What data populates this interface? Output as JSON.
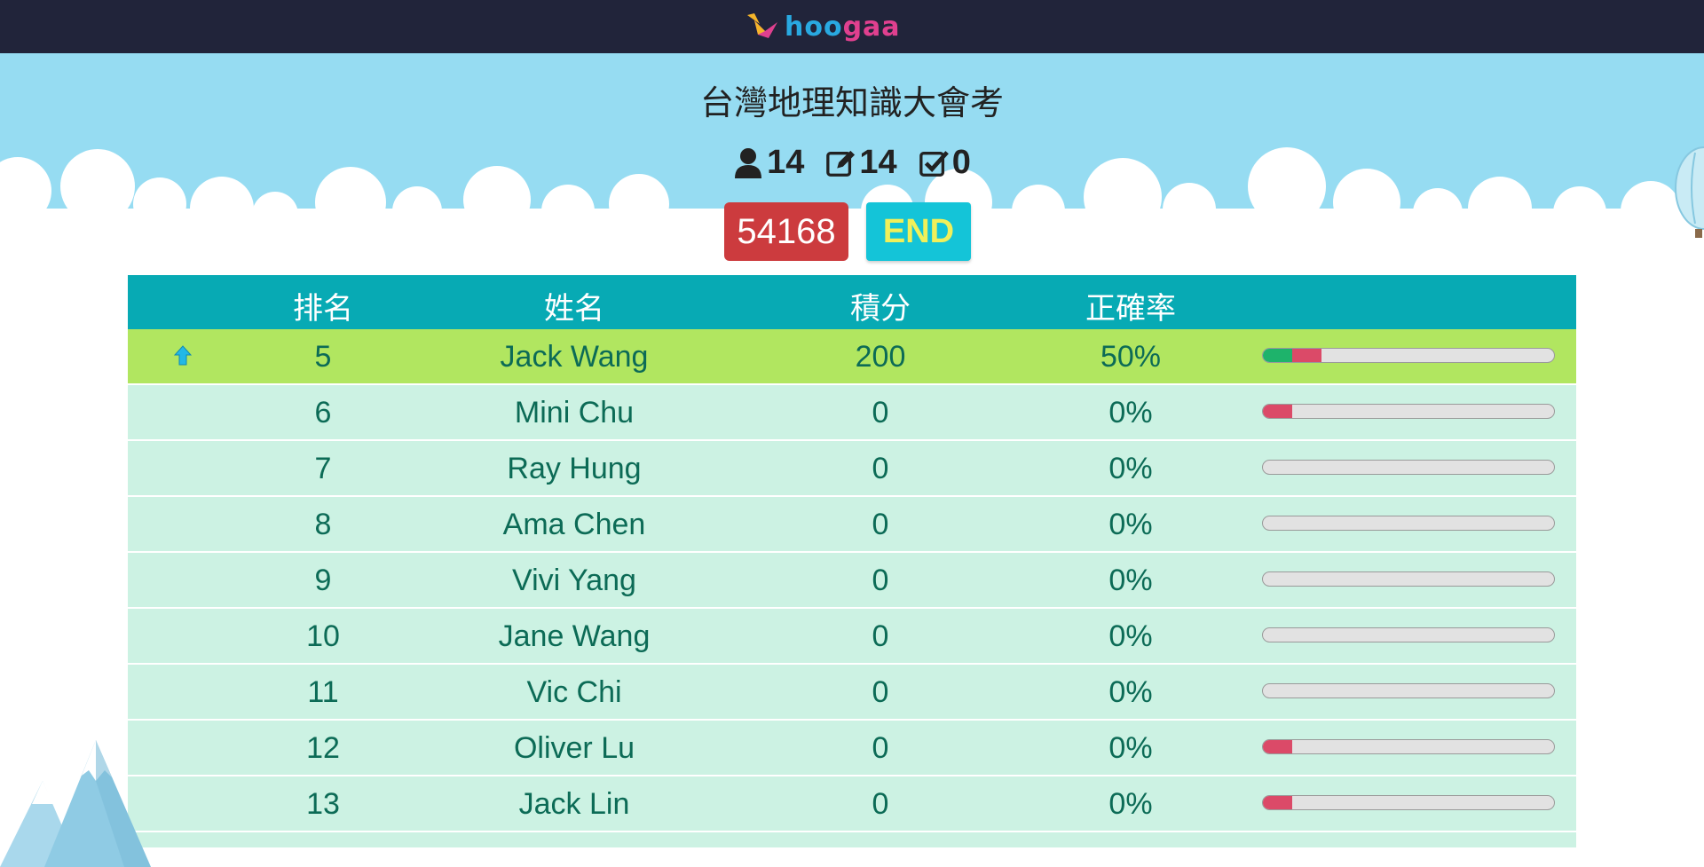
{
  "brand": {
    "logo_text_part1": "hoo",
    "logo_text_part2": "gaa",
    "colors": {
      "hoo": "#29a9e1",
      "gaa": "#e0408f",
      "bird_yellow": "#f5b52a",
      "bird_pink": "#e0408f"
    }
  },
  "quiz": {
    "title": "台灣地理知識大會考"
  },
  "stats": {
    "participants": {
      "icon": "user-icon",
      "value": "14"
    },
    "answered": {
      "icon": "edit-icon",
      "value": "14"
    },
    "correct": {
      "icon": "check-square-icon",
      "value": "0"
    }
  },
  "pin": {
    "value": "54168",
    "color": "#cc3b3e"
  },
  "end_button": {
    "label": "END",
    "color": "#14c4d8"
  },
  "table": {
    "headers": {
      "rank": "排名",
      "name": "姓名",
      "score": "積分",
      "accuracy": "正確率"
    },
    "rows": [
      {
        "rank": "5",
        "name": "Jack Wang",
        "score": "200",
        "accuracy": "50%",
        "trend": "up-arrow-icon",
        "highlight": true,
        "correct_fraction": 0.1,
        "wrong_fraction": 0.1
      },
      {
        "rank": "6",
        "name": "Mini Chu",
        "score": "0",
        "accuracy": "0%",
        "correct_fraction": 0,
        "wrong_fraction": 0.1
      },
      {
        "rank": "7",
        "name": "Ray Hung",
        "score": "0",
        "accuracy": "0%",
        "correct_fraction": 0,
        "wrong_fraction": 0
      },
      {
        "rank": "8",
        "name": "Ama Chen",
        "score": "0",
        "accuracy": "0%",
        "correct_fraction": 0,
        "wrong_fraction": 0
      },
      {
        "rank": "9",
        "name": "Vivi Yang",
        "score": "0",
        "accuracy": "0%",
        "correct_fraction": 0,
        "wrong_fraction": 0
      },
      {
        "rank": "10",
        "name": "Jane Wang",
        "score": "0",
        "accuracy": "0%",
        "correct_fraction": 0,
        "wrong_fraction": 0
      },
      {
        "rank": "11",
        "name": "Vic Chi",
        "score": "0",
        "accuracy": "0%",
        "correct_fraction": 0,
        "wrong_fraction": 0
      },
      {
        "rank": "12",
        "name": "Oliver Lu",
        "score": "0",
        "accuracy": "0%",
        "correct_fraction": 0,
        "wrong_fraction": 0.1
      },
      {
        "rank": "13",
        "name": "Jack Lin",
        "score": "0",
        "accuracy": "0%",
        "correct_fraction": 0,
        "wrong_fraction": 0.1
      }
    ]
  }
}
